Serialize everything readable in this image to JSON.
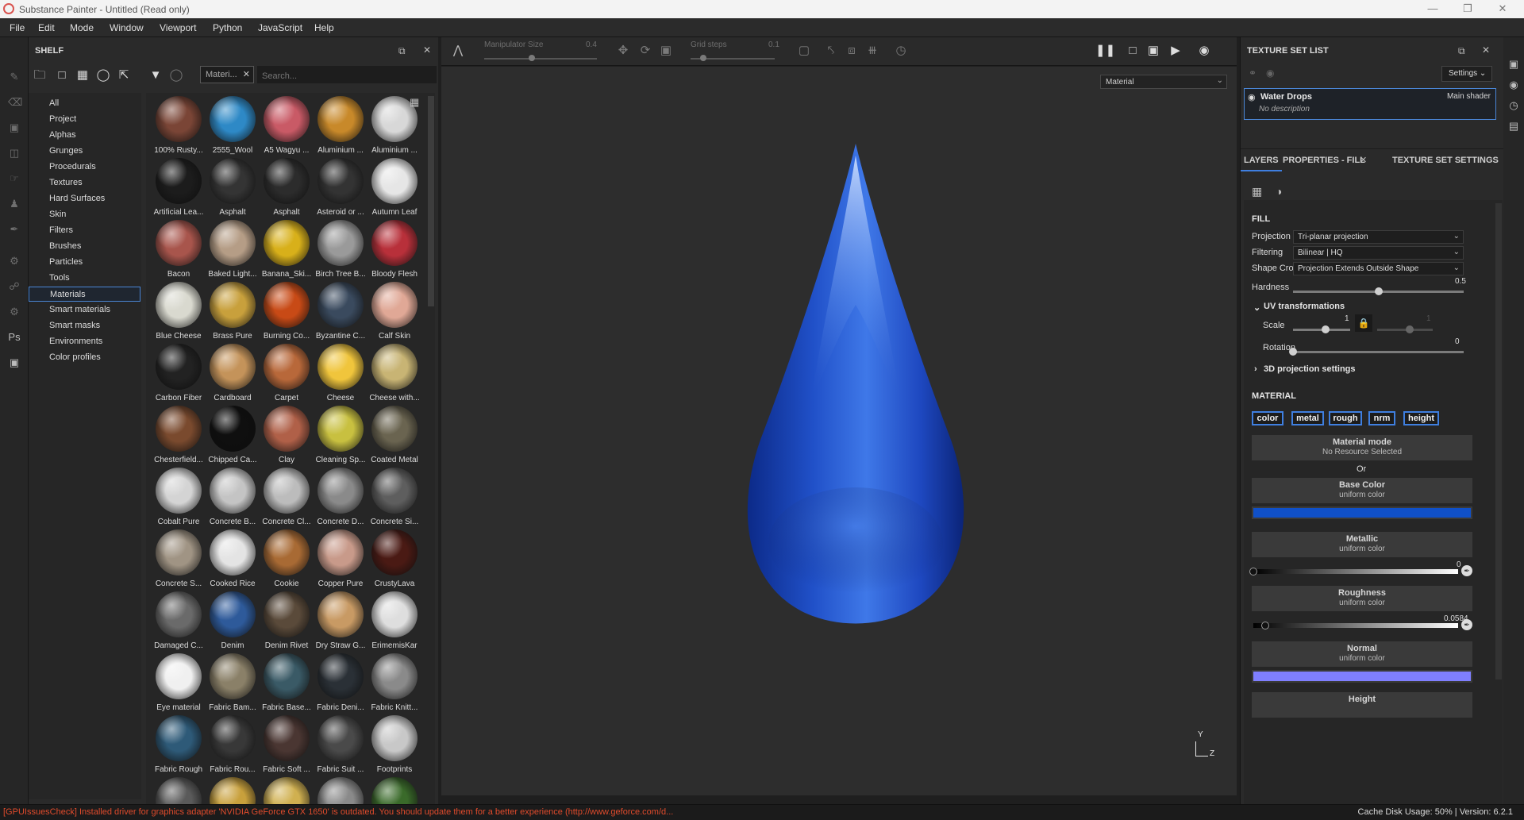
{
  "window": {
    "title": "Substance Painter - Untitled (Read only)"
  },
  "menu": [
    "File",
    "Edit",
    "Mode",
    "Window",
    "Viewport",
    "Python",
    "JavaScript",
    "Help"
  ],
  "shelf": {
    "title": "SHELF",
    "filter_chip": "Materi...",
    "search_placeholder": "Search...",
    "categories": [
      "All",
      "Project",
      "Alphas",
      "Grunges",
      "Procedurals",
      "Textures",
      "Hard Surfaces",
      "Skin",
      "Filters",
      "Brushes",
      "Particles",
      "Tools",
      "Materials",
      "Smart materials",
      "Smart masks",
      "Environments",
      "Color profiles"
    ],
    "selected_category": "Materials",
    "items": [
      {
        "label": "100% Rusty...",
        "color": "#7a4536"
      },
      {
        "label": "2555_Wool",
        "color": "#2e89c6"
      },
      {
        "label": "A5 Wagyu ...",
        "color": "#c95a66"
      },
      {
        "label": "Aluminium ...",
        "color": "#c8892a"
      },
      {
        "label": "Aluminium ...",
        "color": "#d8d8d8"
      },
      {
        "label": "Artificial Lea...",
        "color": "#1c1c1c"
      },
      {
        "label": "Asphalt",
        "color": "#343434"
      },
      {
        "label": "Asphalt",
        "color": "#2c2c2c"
      },
      {
        "label": "Asteroid or ...",
        "color": "#333333"
      },
      {
        "label": "Autumn Leaf",
        "color": "#e6e6e6"
      },
      {
        "label": "Bacon",
        "color": "#a8554c"
      },
      {
        "label": "Baked Light...",
        "color": "#b59d86"
      },
      {
        "label": "Banana_Ski...",
        "color": "#d8b01a"
      },
      {
        "label": "Birch Tree B...",
        "color": "#9a9a9a"
      },
      {
        "label": "Bloody Flesh",
        "color": "#b8303a"
      },
      {
        "label": "Blue Cheese",
        "color": "#d9d9cf"
      },
      {
        "label": "Brass Pure",
        "color": "#c8a03c"
      },
      {
        "label": "Burning Co...",
        "color": "#c84a16"
      },
      {
        "label": "Byzantine C...",
        "color": "#3a4a5e"
      },
      {
        "label": "Calf Skin",
        "color": "#e0a896"
      },
      {
        "label": "Carbon Fiber",
        "color": "#222222"
      },
      {
        "label": "Cardboard",
        "color": "#c4935a"
      },
      {
        "label": "Carpet",
        "color": "#b8683a"
      },
      {
        "label": "Cheese",
        "color": "#f0c53c"
      },
      {
        "label": "Cheese with...",
        "color": "#c8b474"
      },
      {
        "label": "Chesterfield...",
        "color": "#7a4a2e"
      },
      {
        "label": "Chipped Ca...",
        "color": "#0f0f0f"
      },
      {
        "label": "Clay",
        "color": "#b06048"
      },
      {
        "label": "Cleaning Sp...",
        "color": "#c8c040"
      },
      {
        "label": "Coated Metal",
        "color": "#6a6450"
      },
      {
        "label": "Cobalt Pure",
        "color": "#d4d4d4"
      },
      {
        "label": "Concrete B...",
        "color": "#c4c4c4"
      },
      {
        "label": "Concrete Cl...",
        "color": "#bcbcbc"
      },
      {
        "label": "Concrete D...",
        "color": "#8a8a8a"
      },
      {
        "label": "Concrete Si...",
        "color": "#5e5e5e"
      },
      {
        "label": "Concrete S...",
        "color": "#a09484"
      },
      {
        "label": "Cooked Rice",
        "color": "#e4e4e4"
      },
      {
        "label": "Cookie",
        "color": "#a86a34"
      },
      {
        "label": "Copper Pure",
        "color": "#c89a8a"
      },
      {
        "label": "CrustyLava",
        "color": "#4a1a14"
      },
      {
        "label": "Damaged C...",
        "color": "#6a6a6a"
      },
      {
        "label": "Denim",
        "color": "#2e5a9a"
      },
      {
        "label": "Denim Rivet",
        "color": "#5a4a3a"
      },
      {
        "label": "Dry Straw G...",
        "color": "#c89a64"
      },
      {
        "label": "ErimemisKar",
        "color": "#dedede"
      },
      {
        "label": "Eye material",
        "color": "#f0f0f0"
      },
      {
        "label": "Fabric Bam...",
        "color": "#8a8068"
      },
      {
        "label": "Fabric Base...",
        "color": "#3a5a66"
      },
      {
        "label": "Fabric Deni...",
        "color": "#2a3036"
      },
      {
        "label": "Fabric Knitt...",
        "color": "#8a8a8a"
      },
      {
        "label": "Fabric Rough",
        "color": "#2e5a78"
      },
      {
        "label": "Fabric Rou...",
        "color": "#383838"
      },
      {
        "label": "Fabric Soft ...",
        "color": "#4a3632"
      },
      {
        "label": "Fabric Suit ...",
        "color": "#4a4a4a"
      },
      {
        "label": "Footprints",
        "color": "#c8c8c8"
      },
      {
        "label": "",
        "color": "#5a5a5a"
      },
      {
        "label": "",
        "color": "#c8a03c"
      },
      {
        "label": "",
        "color": "#d0b050"
      },
      {
        "label": "",
        "color": "#8a8a8a"
      },
      {
        "label": "",
        "color": "#3a6a2a"
      }
    ]
  },
  "viewport": {
    "manipulator_label": "Manipulator Size",
    "manipulator_value": "0.4",
    "grid_label": "Grid steps",
    "grid_value": "0.1",
    "material_mode": "Material",
    "axis_y": "Y",
    "axis_z": "Z"
  },
  "texture_set_list": {
    "title": "TEXTURE SET LIST",
    "settings": "Settings",
    "item_name": "Water Drops",
    "item_shader": "Main shader",
    "item_desc": "No description"
  },
  "tabs": [
    "LAYERS",
    "PROPERTIES - FILL",
    "TEXTURE SET SETTINGS"
  ],
  "fill": {
    "heading": "FILL",
    "projection_label": "Projection",
    "projection": "Tri-planar projection",
    "filtering_label": "Filtering",
    "filtering": "Bilinear | HQ",
    "shapecrop_label": "Shape Crop",
    "shapecrop": "Projection Extends Outside Shape",
    "hardness_label": "Hardness",
    "hardness": 0.5,
    "hardness_text": "0.5",
    "uv_heading": "UV transformations",
    "scale_label": "Scale",
    "scale_text": "1",
    "scale_text2": "1",
    "rotation_label": "Rotation",
    "rotation_text": "0",
    "proj3d_heading": "3D projection settings"
  },
  "material": {
    "heading": "MATERIAL",
    "channels": [
      "color",
      "metal",
      "rough",
      "nrm",
      "height"
    ],
    "mode_title": "Material mode",
    "mode_sub": "No Resource Selected",
    "or": "Or",
    "base_title": "Base Color",
    "base_sub": "uniform color",
    "base_color": "#1050c8",
    "metallic_title": "Metallic",
    "metallic_sub": "uniform color",
    "metallic": 0,
    "metallic_text": "0",
    "rough_title": "Roughness",
    "rough_sub": "uniform color",
    "roughness": 0.0584,
    "rough_text": "0.0584",
    "normal_title": "Normal",
    "normal_sub": "uniform color",
    "normal_color": "#7f7fff",
    "height_title": "Height"
  },
  "status": {
    "error": "[GPUIssuesCheck] Installed driver for graphics adapter 'NVIDIA GeForce GTX 1650' is outdated. You should update them for a better experience (http://www.geforce.com/d...",
    "cache": "Cache Disk Usage:    50% | Version: 6.2.1"
  }
}
